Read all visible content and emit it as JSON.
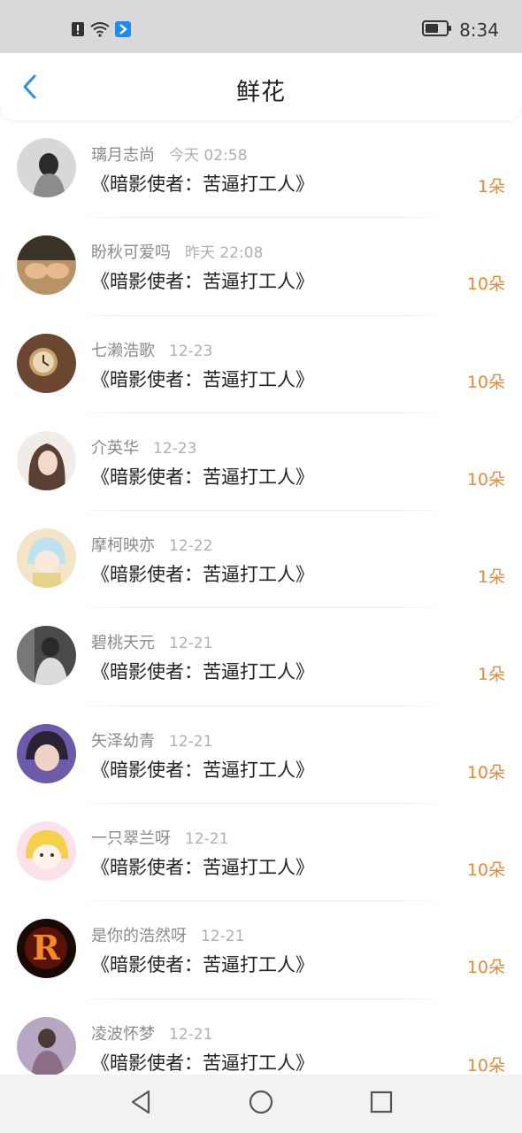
{
  "status_bar": {
    "time": "8:34",
    "icons": [
      "alert-icon",
      "wifi-icon",
      "notification-app-icon",
      "battery-icon"
    ]
  },
  "header": {
    "title": "鲜花",
    "back_icon": "chevron-left-icon"
  },
  "colors": {
    "accent_blue": "#2f8fe8",
    "count_orange": "#e58a3a"
  },
  "items": [
    {
      "user": "璃月志尚",
      "time": "今天 02:58",
      "book": "《暗影使者：苦逼打工人》",
      "count": "1朵"
    },
    {
      "user": "盼秋可爱吗",
      "time": "昨天 22:08",
      "book": "《暗影使者：苦逼打工人》",
      "count": "10朵"
    },
    {
      "user": "七濑浩歌",
      "time": "12-23",
      "book": "《暗影使者：苦逼打工人》",
      "count": "10朵"
    },
    {
      "user": "介英华",
      "time": "12-23",
      "book": "《暗影使者：苦逼打工人》",
      "count": "10朵"
    },
    {
      "user": "摩柯映亦",
      "time": "12-22",
      "book": "《暗影使者：苦逼打工人》",
      "count": "1朵"
    },
    {
      "user": "碧桃天元",
      "time": "12-21",
      "book": "《暗影使者：苦逼打工人》",
      "count": "1朵"
    },
    {
      "user": "矢泽幼青",
      "time": "12-21",
      "book": "《暗影使者：苦逼打工人》",
      "count": "10朵"
    },
    {
      "user": "一只翠兰呀",
      "time": "12-21",
      "book": "《暗影使者：苦逼打工人》",
      "count": "10朵"
    },
    {
      "user": "是你的浩然呀",
      "time": "12-21",
      "book": "《暗影使者：苦逼打工人》",
      "count": "10朵"
    },
    {
      "user": "凌波怀梦",
      "time": "12-21",
      "book": "《暗影使者：苦逼打工人》",
      "count": "10朵"
    }
  ],
  "system_nav": [
    "back-triangle-icon",
    "home-circle-icon",
    "recents-square-icon"
  ]
}
